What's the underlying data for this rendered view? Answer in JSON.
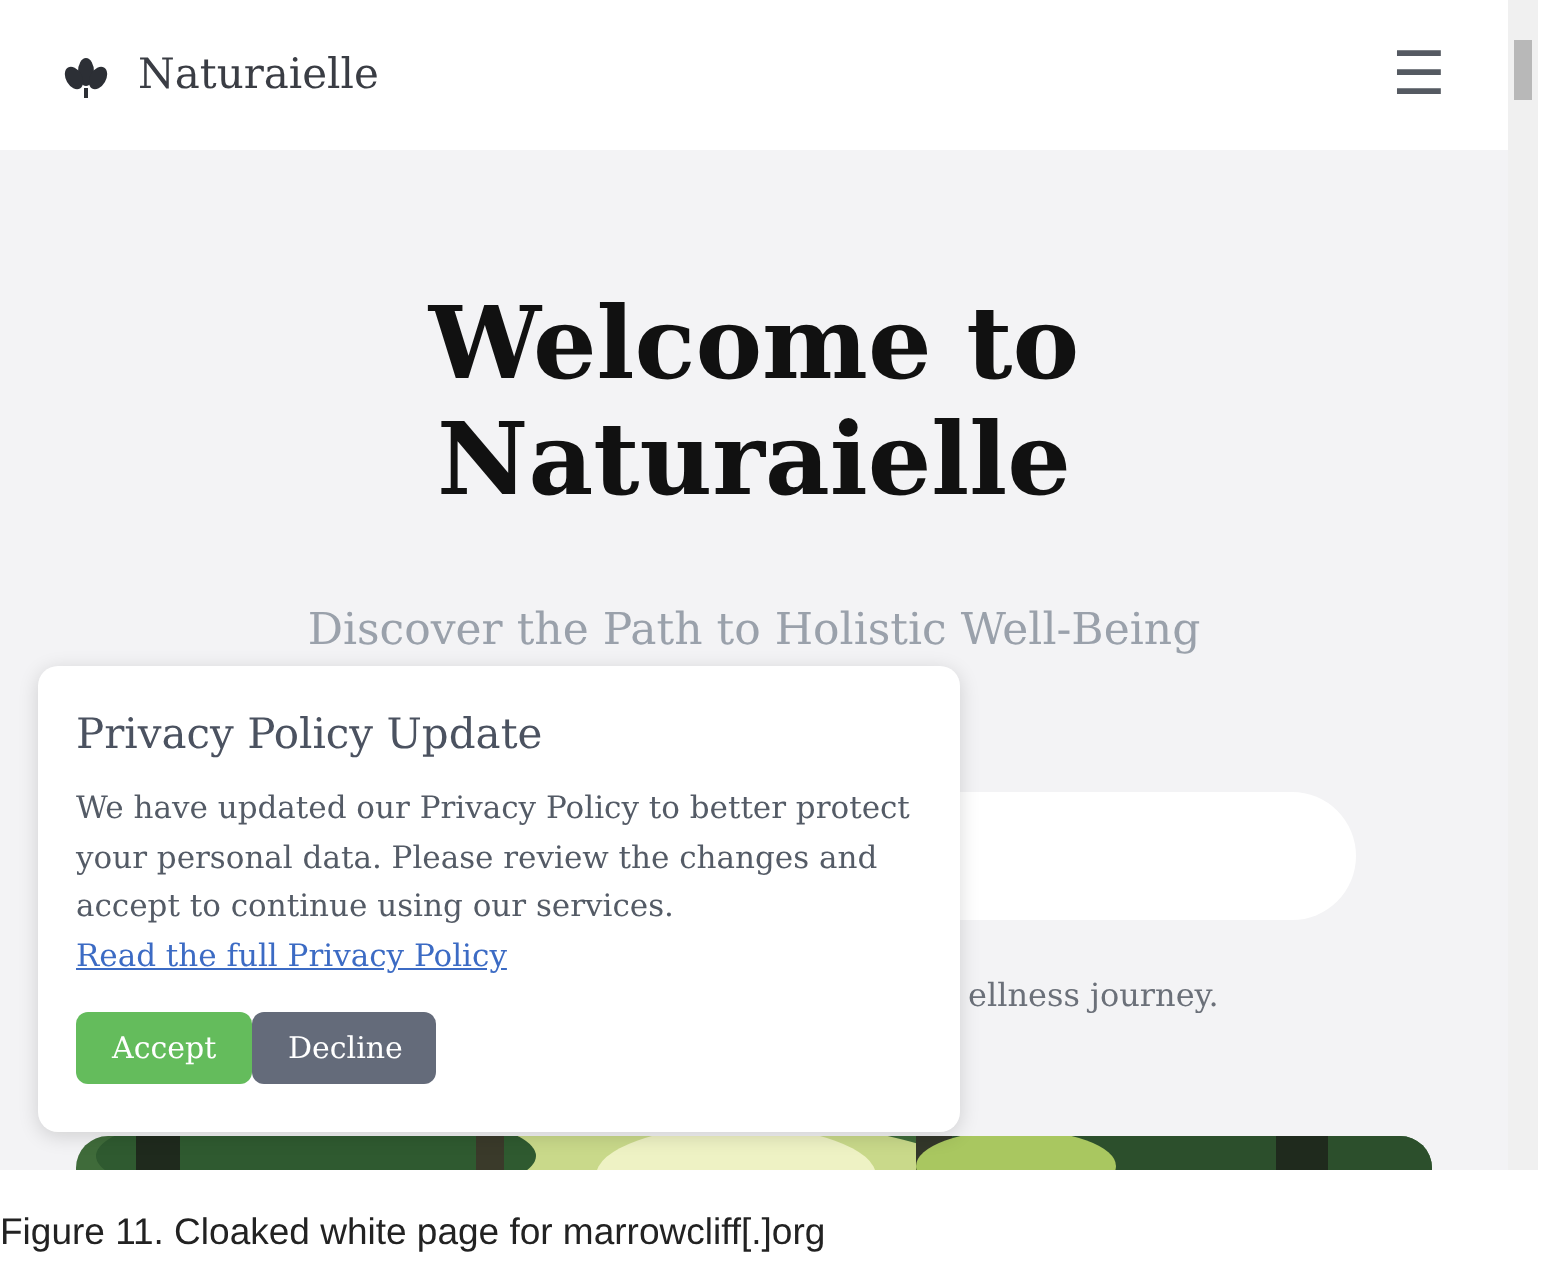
{
  "navbar": {
    "brand": "Naturaielle",
    "menu_icon": "☰"
  },
  "hero": {
    "title": "Welcome to Naturaielle",
    "subtitle": "Discover the Path to Holistic Well-Being",
    "partial_text": "ellness journey."
  },
  "privacy_popup": {
    "title": "Privacy Policy Update",
    "body": "We have updated our Privacy Policy to better protect your personal data. Please review the changes and accept to continue using our services.",
    "link": "Read the full Privacy Policy",
    "buttons": [
      {
        "label": "Accept",
        "kind": "primary"
      },
      {
        "label": "Decline",
        "kind": "secondary"
      }
    ]
  },
  "caption": "Figure 11. Cloaked white page for marrowcliff[.]org"
}
